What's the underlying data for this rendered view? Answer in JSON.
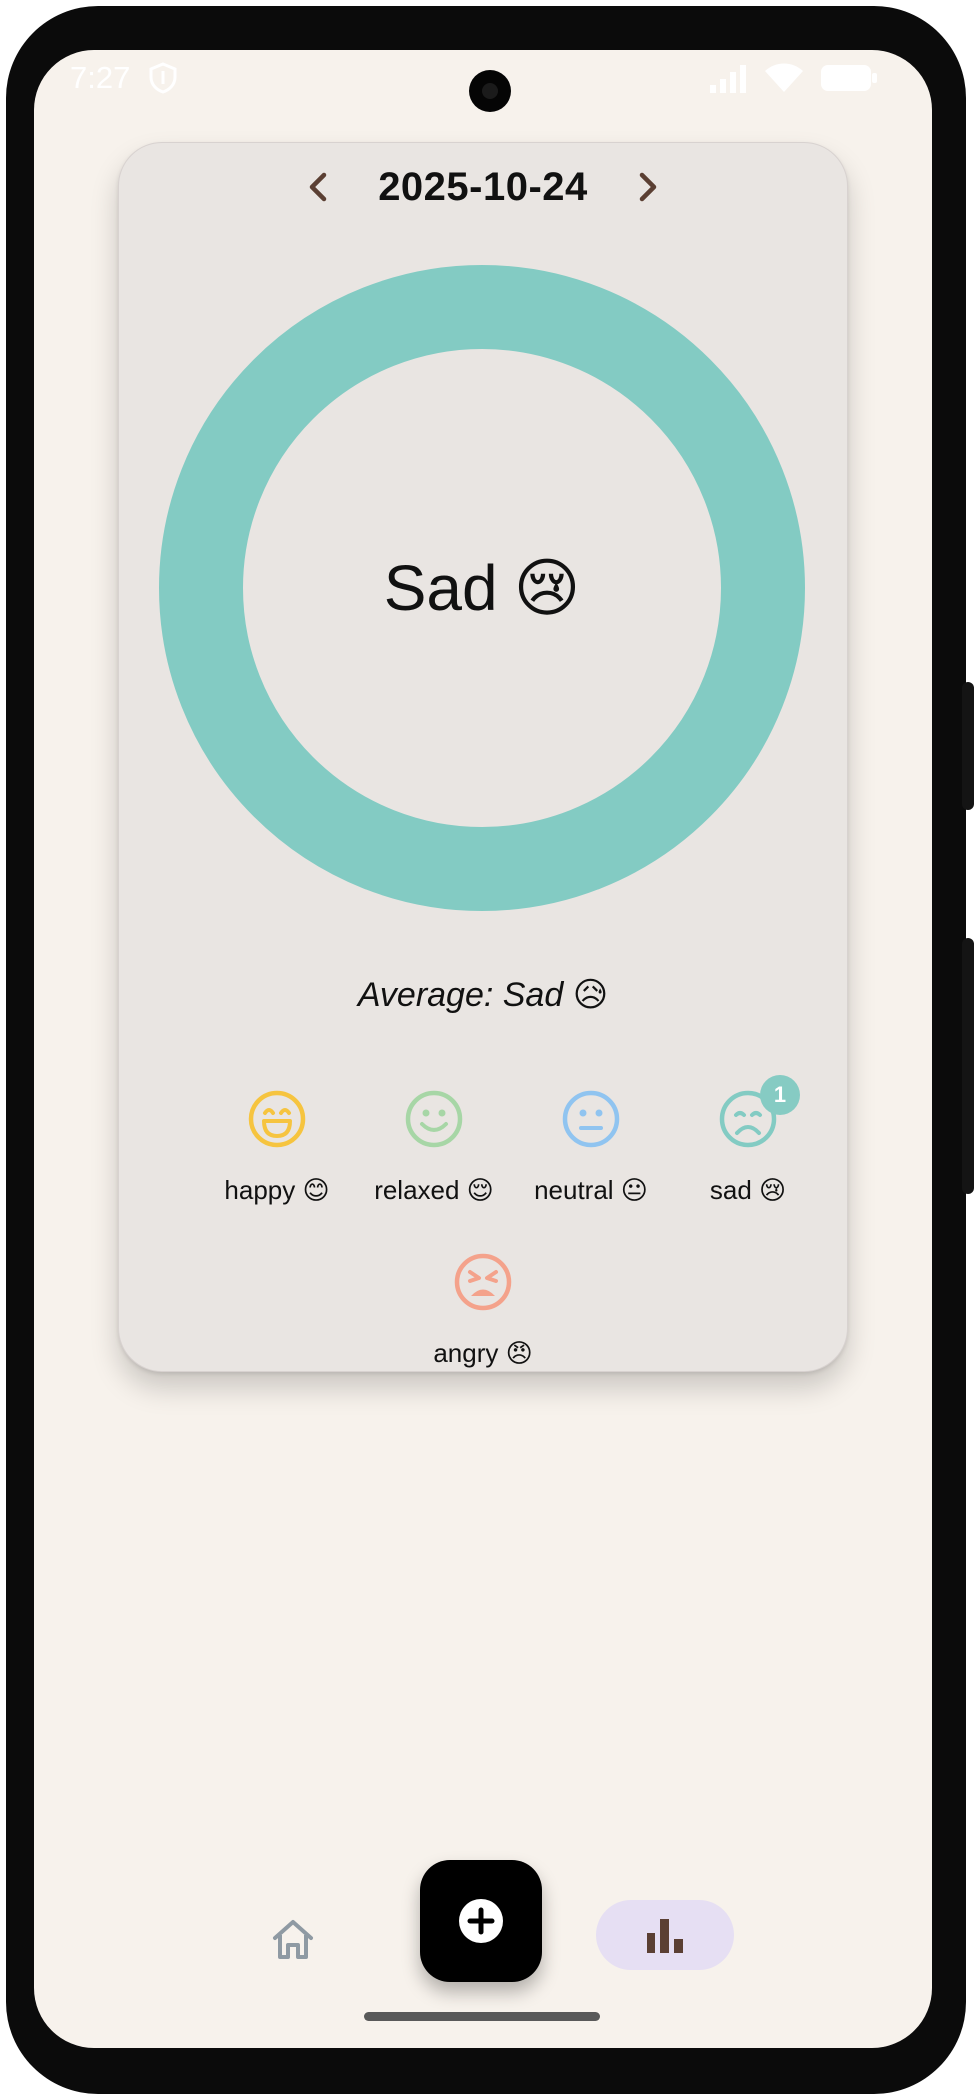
{
  "status_bar": {
    "time": "7:27"
  },
  "header": {
    "date": "2025-10-24",
    "prev_icon": "chevron-left-icon",
    "next_icon": "chevron-right-icon"
  },
  "chart_data": {
    "type": "pie",
    "categories": [
      "sad"
    ],
    "values": [
      1
    ],
    "colors": [
      "#83cbc3"
    ]
  },
  "summary": {
    "current_mood": "Sad",
    "current_emoji": "😢",
    "average_text": "Average: Sad 😥"
  },
  "moods": [
    {
      "label": "happy 😊",
      "icon": "laughing-face-icon",
      "color": "#f6c43f",
      "count": null
    },
    {
      "label": "relaxed 😌",
      "icon": "smiling-face-icon",
      "color": "#a7d6a6",
      "count": null
    },
    {
      "label": "neutral 😐",
      "icon": "neutral-face-icon",
      "color": "#90c4f0",
      "count": null
    },
    {
      "label": "sad 😢",
      "icon": "frowning-face-icon",
      "color": "#83cbc3",
      "count": "1"
    },
    {
      "label": "angry 😠",
      "icon": "angry-face-icon",
      "color": "#f4a28b",
      "count": null
    }
  ],
  "bottom_nav": {
    "home_icon": "home-icon",
    "add_icon": "plus-circle-icon",
    "stats_icon": "bar-chart-icon",
    "active": "stats"
  },
  "colors": {
    "background": "#f7f2ec",
    "card": "#e9e5e2",
    "accent": "#83cbc3",
    "nav_active": "#e6dff3",
    "brown": "#5b3f33"
  }
}
